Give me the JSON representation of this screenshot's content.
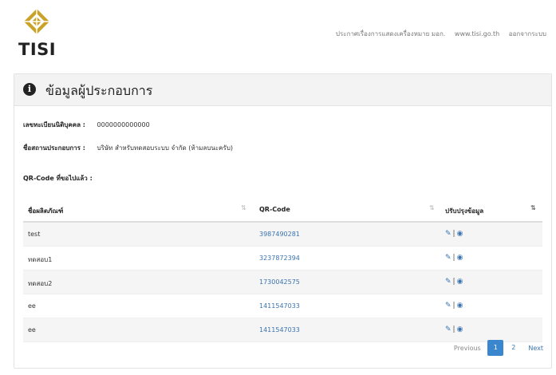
{
  "header": {
    "logo_text": "TISI",
    "nav": [
      "ประกาศเรื่องการแสดงเครื่องหมาย มอก.",
      "www.tisi.go.th",
      "ออกจากระบบ"
    ]
  },
  "panel": {
    "title": "ข้อมูลผู้ประกอบการ",
    "fields": [
      {
        "label": "เลขทะเบียนนิติบุคคล :",
        "value": "0000000000000"
      },
      {
        "label": "ชื่อสถานประกอบการ :",
        "value": "บริษัท สำหรับทดสอบระบบ จำกัด (ห้ามลบนะครับ)"
      }
    ],
    "qr_label": "QR-Code ที่ขอไปแล้ว :"
  },
  "table": {
    "columns": [
      "ชื่อผลิตภัณฑ์",
      "QR-Code",
      "ปรับปรุงข้อมูล"
    ],
    "rows": [
      {
        "product": "test",
        "qr": "3987490281"
      },
      {
        "product": "ทดสอบ1",
        "qr": "3237872394"
      },
      {
        "product": "ทดสอบ2",
        "qr": "1730042575"
      },
      {
        "product": "ee",
        "qr": "1411547033"
      },
      {
        "product": "ee",
        "qr": "1411547033"
      }
    ]
  },
  "pagination": {
    "previous": "Previous",
    "pages": [
      "1",
      "2"
    ],
    "next": "Next",
    "current": "1"
  },
  "colors": {
    "link": "#3a73b0",
    "active_page": "#3a87d0",
    "logo_gold": "#c9a227"
  }
}
